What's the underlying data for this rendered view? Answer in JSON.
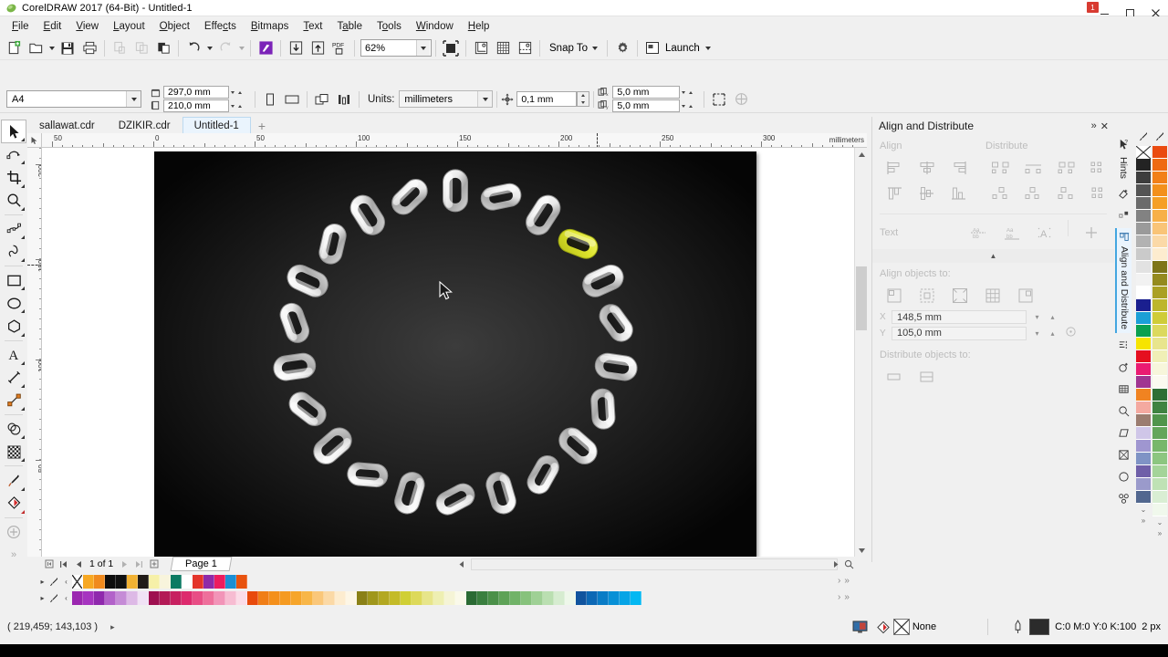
{
  "window": {
    "title": "CorelDRAW 2017 (64-Bit) - Untitled-1",
    "logo_icon": "coreldraw-balloon-icon",
    "notification_badge": "1",
    "minimize_label": "—",
    "maximize_label": "❐",
    "close_label": "✕"
  },
  "menu": {
    "items": [
      {
        "label": "File",
        "accel": "F"
      },
      {
        "label": "Edit",
        "accel": "E"
      },
      {
        "label": "View",
        "accel": "V"
      },
      {
        "label": "Layout",
        "accel": "L"
      },
      {
        "label": "Object",
        "accel": "O"
      },
      {
        "label": "Effects",
        "accel": "c"
      },
      {
        "label": "Bitmaps",
        "accel": "B"
      },
      {
        "label": "Text",
        "accel": "T"
      },
      {
        "label": "Table",
        "accel": "a"
      },
      {
        "label": "Tools",
        "accel": "o"
      },
      {
        "label": "Window",
        "accel": "W"
      },
      {
        "label": "Help",
        "accel": "H"
      }
    ]
  },
  "toolbar": {
    "new_label": "new-document",
    "open_label": "open",
    "save_label": "save",
    "print_label": "print",
    "cut_label": "cut",
    "copy_label": "copy",
    "paste_label": "paste",
    "undo_label": "undo",
    "redo_label": "redo",
    "search_content_label": "search-content",
    "import_label": "import",
    "export_label": "export",
    "export_pdf_label": "PDF",
    "zoom_value": "62%",
    "fullscreen_label": "full-screen-preview",
    "show_rulers_label": "show-rulers",
    "show_grid_label": "show-grid",
    "show_guides_label": "show-guides",
    "snap_to_label": "Snap To",
    "options_label": "options",
    "launch_label": "Launch"
  },
  "propertybar": {
    "page_size": "A4",
    "page_width": "297,0 mm",
    "page_height": "210,0 mm",
    "portrait_label": "portrait",
    "landscape_label": "landscape",
    "all_pages_label": "all-pages",
    "current_page_label": "current-page-only",
    "units_label": "Units:",
    "units_value": "millimeters",
    "nudge_value": "0,1 mm",
    "duplicate_x": "5,0 mm",
    "duplicate_y": "5,0 mm",
    "page_border_label": "page-border",
    "bleed_label": "bleed"
  },
  "tabs": {
    "documents": [
      {
        "label": "sallawat.cdr",
        "active": false
      },
      {
        "label": "DZIKIR.cdr",
        "active": false
      },
      {
        "label": "Untitled-1",
        "active": true
      }
    ],
    "add_label": "+"
  },
  "toolbox": {
    "tools": [
      {
        "name": "pick-tool",
        "selected": true
      },
      {
        "name": "shape-tool",
        "selected": false
      },
      {
        "name": "crop-tool",
        "selected": false
      },
      {
        "name": "zoom-tool",
        "selected": false
      },
      {
        "name": "freehand-tool",
        "selected": false
      },
      {
        "name": "artistic-media-tool",
        "selected": false
      },
      {
        "name": "rectangle-tool",
        "selected": false
      },
      {
        "name": "ellipse-tool",
        "selected": false
      },
      {
        "name": "polygon-tool",
        "selected": false
      },
      {
        "name": "text-tool",
        "selected": false
      },
      {
        "name": "parallel-dimension-tool",
        "selected": false
      },
      {
        "name": "straight-line-connector-tool",
        "selected": false
      },
      {
        "name": "drop-shadow-tool",
        "selected": false
      },
      {
        "name": "transparency-tool",
        "selected": false
      },
      {
        "name": "color-eyedropper-tool",
        "selected": false
      },
      {
        "name": "interactive-fill-tool",
        "selected": false
      },
      {
        "name": "quick-customize",
        "selected": false
      }
    ]
  },
  "rulers": {
    "units": "millimeters",
    "horizontal_labels": [
      "50",
      "0",
      "50",
      "100",
      "150",
      "200",
      "250",
      "300"
    ],
    "vertical_labels": [
      "200",
      "150",
      "100",
      "50"
    ]
  },
  "canvas": {
    "artwork_name": "chain-ring-illustration",
    "selected_link_color": "#d4e02a",
    "background_color": "#0a0a0a",
    "cursor_position_label": "pointer"
  },
  "pagenav": {
    "first_label": "first-page",
    "prev_label": "previous-page",
    "counter": "1 of 1",
    "next_label": "next-page",
    "last_label": "last-page",
    "add_page_label": "add-page",
    "page_tab": "Page 1"
  },
  "docker": {
    "title": "Align and Distribute",
    "collapse_label": "»",
    "close_label": "✕",
    "align_label": "Align",
    "distribute_label": "Distribute",
    "text_label": "Text",
    "align_objects_to_label": "Align objects to:",
    "distribute_objects_to_label": "Distribute objects to:",
    "x_label": "X",
    "y_label": "Y",
    "x_value": "148,5 mm",
    "y_value": "105,0 mm",
    "align_buttons": [
      "align-left",
      "align-center-horizontally",
      "align-right",
      "align-top",
      "align-center-vertically",
      "align-bottom"
    ],
    "distribute_buttons": [
      "distribute-left",
      "distribute-center-horizontal",
      "distribute-right",
      "distribute-space-horizontal",
      "distribute-top",
      "distribute-center-vertical",
      "distribute-bottom",
      "distribute-space-vertical"
    ],
    "text_buttons": [
      "align-text-baseline",
      "align-text-bounding-box",
      "align-text-outline",
      "align-text-node"
    ],
    "align_to_buttons": [
      "active-object",
      "edge-of-page",
      "center-of-page",
      "grid",
      "specified-point"
    ],
    "distribute_to_buttons": [
      "extent-of-selection",
      "extent-of-page"
    ]
  },
  "docker_strip": {
    "tabs": [
      {
        "name": "hints",
        "label": "Hints",
        "active": false
      },
      {
        "name": "object-properties",
        "label": "",
        "active": false
      },
      {
        "name": "object-manager",
        "label": "",
        "active": false
      },
      {
        "name": "align-and-distribute",
        "label": "Align and Distribute",
        "active": true
      },
      {
        "name": "object-styles",
        "label": "",
        "active": false
      },
      {
        "name": "transformations",
        "label": "",
        "active": false
      },
      {
        "name": "color-palette-manager",
        "label": "",
        "active": false
      },
      {
        "name": "find-replace",
        "label": "",
        "active": false
      },
      {
        "name": "shape-edit",
        "label": "",
        "active": false
      },
      {
        "name": "envelope",
        "label": "",
        "active": false
      },
      {
        "name": "lens",
        "label": "",
        "active": false
      },
      {
        "name": "symbol-manager",
        "label": "",
        "active": false
      }
    ]
  },
  "statusbar": {
    "coordinates": "( 219,459; 143,103 )",
    "expand_label": "▸",
    "color_proof_label": "color-proof-settings",
    "fill_label": "None",
    "outline_color": "C:0 M:0 Y:0 K:100",
    "outline_width": "2 px",
    "outline_swatch_hex": "#2b2b2b"
  },
  "palette": {
    "top_row": [
      "none",
      "#f7a823",
      "#f08a1e",
      "#0d0d0d",
      "#101010",
      "#f2b233",
      "#211c18",
      "#f6f0a8",
      "#f8f4dc",
      "#0c7a63",
      "#ffffff",
      "#e4352b",
      "#8e2aa8",
      "#ec1c5e",
      "#1b8fd4",
      "#e8530f"
    ],
    "bottom_row": [
      "#9b27b0",
      "#a634c0",
      "#8f28ad",
      "#b261c9",
      "#c58bd6",
      "#ddb9e6",
      "#f0e2f5",
      "#9e1050",
      "#b31a56",
      "#c72060",
      "#dd2a6d",
      "#e84d85",
      "#ee6f9b",
      "#f294b8",
      "#f7bcd2",
      "#fbdce8",
      "#e84a0c",
      "#f07e17",
      "#f4901c",
      "#f59a20",
      "#f6a52a",
      "#f8b648",
      "#fac77a",
      "#fbd9a6",
      "#fdeccf",
      "#fdf6e6",
      "#8a8016",
      "#a0971c",
      "#b3a821",
      "#c4bb28",
      "#d0cf35",
      "#ddd95a",
      "#e7e58a",
      "#eeefb2",
      "#f5f4d6",
      "#faf9ea",
      "#2b6b34",
      "#3a7f3f",
      "#4b9049",
      "#5ea257",
      "#71b368",
      "#87c27c",
      "#9fd095",
      "#badfb1",
      "#d6ecd0",
      "#eef7ea",
      "#11549e",
      "#0d68b5",
      "#0a7cc6",
      "#0890d6",
      "#06a4e6",
      "#04b8f2"
    ],
    "right_col_a": [
      "none",
      "#232323",
      "#3d3d3d",
      "#545454",
      "#6b6b6b",
      "#828282",
      "#9a9a9a",
      "#b2b2b2",
      "#cacaca",
      "#e2e2e2",
      "#f2f2f2",
      "#ffffff",
      "#1a1f8f",
      "#1b9fd6",
      "#0ba04f",
      "#f6e400",
      "#e50f1f",
      "#ea1b72",
      "#a03591",
      "#f08321",
      "#f4a9a0",
      "#9b7d70",
      "#cfc6e8",
      "#9f96d0",
      "#7f93c5",
      "#6f5fa8",
      "#9a9acb",
      "#52678f"
    ],
    "right_col_b": [
      "#ea4b10",
      "#ef6a12",
      "#f28018",
      "#f3901c",
      "#f59f26",
      "#f7b048",
      "#f9c477",
      "#fbd9a7",
      "#fdeccf",
      "#7d7519",
      "#948a1e",
      "#aaa024",
      "#bdb62b",
      "#cfcc38",
      "#dcd95d",
      "#e8e58d",
      "#f0efb6",
      "#f7f6db",
      "#fbfaf0",
      "#2e6f35",
      "#3f8341",
      "#50954b",
      "#63a65a",
      "#77b76b",
      "#8cc680",
      "#a4d499",
      "#bfe2b5",
      "#d9eed3",
      "#f0f8ec"
    ]
  }
}
